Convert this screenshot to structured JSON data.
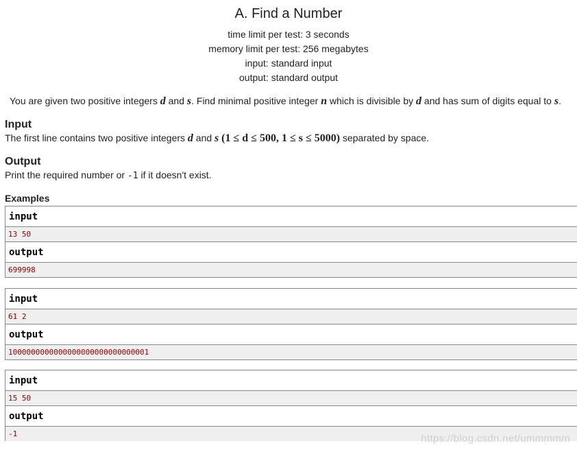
{
  "problem": {
    "title": "A. Find a Number",
    "time_limit": "time limit per test: 3 seconds",
    "memory_limit": "memory limit per test: 256 megabytes",
    "input_file": "input: standard input",
    "output_file": "output: standard output"
  },
  "statement": {
    "p1": "You are given two positive integers ",
    "var_d": "d",
    "and": " and ",
    "var_s": "s",
    "p2": ". Find minimal positive integer ",
    "var_n": "n",
    "p3": " which is divisible by ",
    "p4": " and has sum of digits equal to ",
    "end": "."
  },
  "input_section": {
    "title": "Input",
    "text1": "The first line contains two positive integers ",
    "constraint": "(1 ≤ d ≤ 500, 1 ≤ s ≤ 5000)",
    "text2": " separated by space."
  },
  "output_section": {
    "title": "Output",
    "text1": "Print the required number or ",
    "code": "-1",
    "text2": " if it doesn't exist."
  },
  "examples_title": "Examples",
  "examples": [
    {
      "input_label": "input",
      "input": "13 50",
      "output_label": "output",
      "output": "699998"
    },
    {
      "input_label": "input",
      "input": "61 2",
      "output_label": "output",
      "output": "1000000000000000000000000000001"
    },
    {
      "input_label": "input",
      "input": "15 50",
      "output_label": "output",
      "output": "-1"
    }
  ],
  "watermark": "https://blog.csdn.net/ummmmm"
}
